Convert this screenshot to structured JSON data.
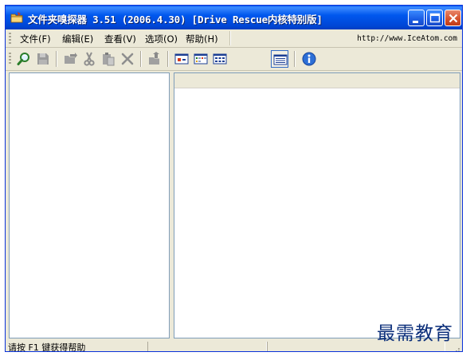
{
  "window": {
    "title": "文件夹嗅探器 3.51 (2006.4.30) [Drive Rescue内核特别版]"
  },
  "menu": {
    "items": [
      {
        "label": "文件(F)"
      },
      {
        "label": "编辑(E)"
      },
      {
        "label": "查看(V)"
      },
      {
        "label": "选项(O)"
      },
      {
        "label": "帮助(H)"
      }
    ],
    "url": "http://www.IceAtom.com"
  },
  "toolbar": {
    "buttons": [
      {
        "icon": "scan-search-icon"
      },
      {
        "icon": "save-icon"
      },
      {
        "icon": "move-icon"
      },
      {
        "icon": "cut-icon"
      },
      {
        "icon": "paste-icon"
      },
      {
        "icon": "delete-icon"
      },
      {
        "icon": "export-icon"
      },
      {
        "icon": "view-large-icons-icon"
      },
      {
        "icon": "view-small-icons-icon"
      },
      {
        "icon": "view-list-icon"
      },
      {
        "icon": "view-details-icon",
        "active": true
      },
      {
        "icon": "info-icon"
      }
    ]
  },
  "statusbar": {
    "text": "请按 F1 键获得帮助"
  },
  "watermark": {
    "text": "最需教育"
  },
  "colors": {
    "titlebar": "#0058ee",
    "window_bg": "#ece9d8",
    "close_button": "#d6542e",
    "pane_border": "#7f9db9"
  }
}
